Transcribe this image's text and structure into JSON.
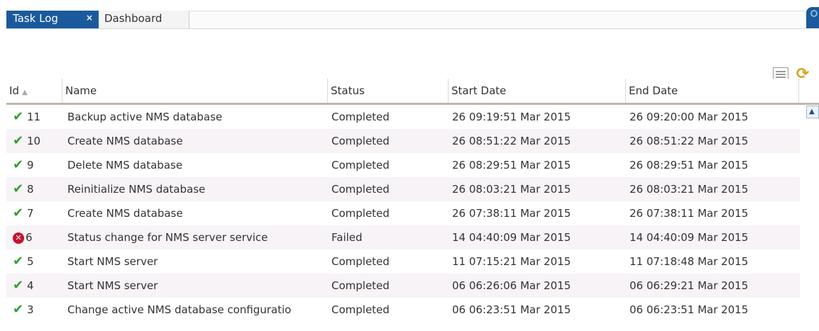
{
  "tabs": [
    {
      "label": "Task Log",
      "close": "×"
    },
    {
      "label": "Dashboard"
    }
  ],
  "table": {
    "headers": {
      "id": "Id",
      "name": "Name",
      "status": "Status",
      "start": "Start Date",
      "end": "End Date"
    },
    "rows": [
      {
        "status_icon": "check-icon",
        "id": "11",
        "name": "Backup active NMS database",
        "status": "Completed",
        "start": "26 09:19:51 Mar 2015",
        "end": "26 09:20:00 Mar 2015"
      },
      {
        "status_icon": "check-icon",
        "id": "10",
        "name": "Create NMS database",
        "status": "Completed",
        "start": "26 08:51:22 Mar 2015",
        "end": "26 08:51:22 Mar 2015"
      },
      {
        "status_icon": "check-icon",
        "id": "9",
        "name": "Delete NMS database",
        "status": "Completed",
        "start": "26 08:29:51 Mar 2015",
        "end": "26 08:29:51 Mar 2015"
      },
      {
        "status_icon": "check-icon",
        "id": "8",
        "name": "Reinitialize NMS database",
        "status": "Completed",
        "start": "26 08:03:21 Mar 2015",
        "end": "26 08:03:21 Mar 2015"
      },
      {
        "status_icon": "check-icon",
        "id": "7",
        "name": "Create NMS database",
        "status": "Completed",
        "start": "26 07:38:11 Mar 2015",
        "end": "26 07:38:11 Mar 2015"
      },
      {
        "status_icon": "error-icon",
        "id": "6",
        "name": "Status change for NMS server service",
        "status": "Failed",
        "start": "14 04:40:09 Mar 2015",
        "end": "14 04:40:09 Mar 2015"
      },
      {
        "status_icon": "check-icon",
        "id": "5",
        "name": "Start NMS server",
        "status": "Completed",
        "start": "11 07:15:21 Mar 2015",
        "end": "11 07:18:48 Mar 2015"
      },
      {
        "status_icon": "check-icon",
        "id": "4",
        "name": "Start NMS server",
        "status": "Completed",
        "start": "06 06:26:06 Mar 2015",
        "end": "06 06:29:21 Mar 2015"
      },
      {
        "status_icon": "check-icon",
        "id": "3",
        "name": "Change active NMS database configuratio",
        "status": "Completed",
        "start": "06 06:23:51 Mar 2015",
        "end": "06 06:23:51 Mar 2015"
      }
    ]
  },
  "colors": {
    "tab_active": "#1a5a9c",
    "ok": "#2ea02e",
    "fail": "#c8102e"
  }
}
